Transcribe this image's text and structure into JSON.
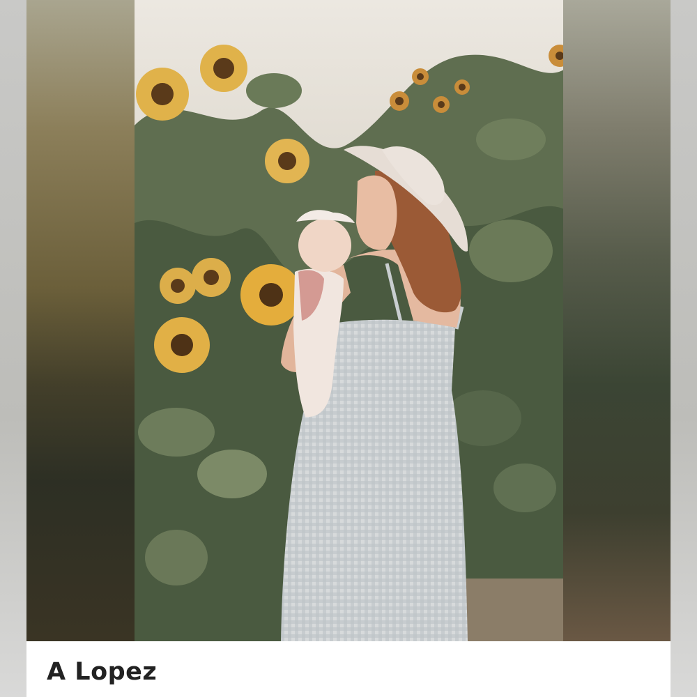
{
  "caption": {
    "name": "A Lopez"
  },
  "photo": {
    "subject": "woman-holding-baby-in-sunflower-field",
    "colors": {
      "sky": "#e9e5de",
      "foliage": "#55644a",
      "sunflower_petal": "#e0b24a",
      "sunflower_center": "#5a3a1a",
      "dress": "#c9ced0",
      "hat": "#e6ddd5",
      "hair": "#9b5a36"
    }
  }
}
